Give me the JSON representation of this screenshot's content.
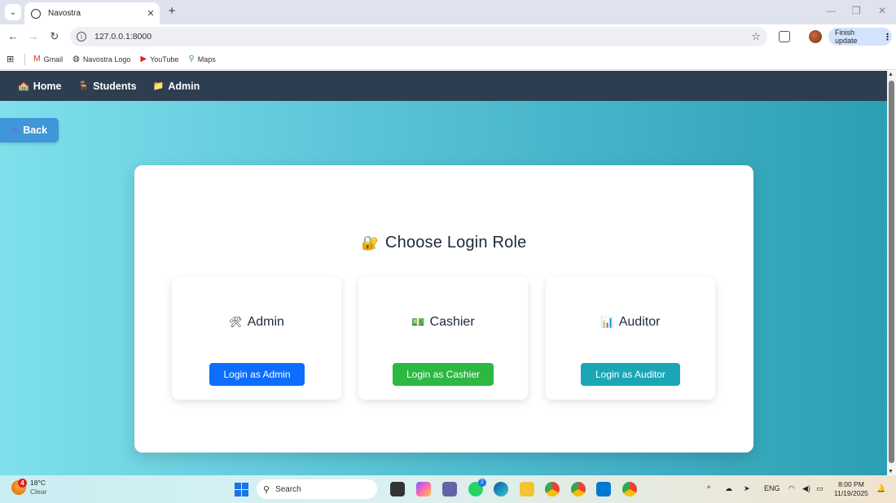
{
  "browser": {
    "tab_title": "Navostra",
    "url": "127.0.0.1:8000",
    "finish_update_label": "Finish update",
    "bookmarks": [
      {
        "label": "Gmail",
        "icon": "gmail-icon"
      },
      {
        "label": "Navostra Logo",
        "icon": "globe-icon"
      },
      {
        "label": "YouTube",
        "icon": "youtube-icon"
      },
      {
        "label": "Maps",
        "icon": "maps-icon"
      }
    ]
  },
  "site_nav": {
    "items": [
      {
        "label": "Home",
        "icon": "🏫"
      },
      {
        "label": "Students",
        "icon": "🪑"
      },
      {
        "label": "Admin",
        "icon": "📁"
      }
    ]
  },
  "back_button": {
    "label": "Back",
    "icon": "⇦"
  },
  "card": {
    "title": "Choose Login Role",
    "title_icon": "🔐",
    "roles": [
      {
        "name": "Admin",
        "icon": "🛠",
        "button": "Login as Admin",
        "color": "#0d6efd"
      },
      {
        "name": "Cashier",
        "icon": "💵",
        "button": "Login as Cashier",
        "color": "#2db843"
      },
      {
        "name": "Auditor",
        "icon": "📊",
        "button": "Login as Auditor",
        "color": "#1aa6b5"
      }
    ]
  },
  "taskbar": {
    "weather_temp": "18°C",
    "weather_desc": "Clear",
    "weather_badge": "4",
    "search_placeholder": "Search",
    "whatsapp_badge": "2",
    "language": "ENG",
    "time": "8:00 PM",
    "date": "11/19/2025"
  }
}
